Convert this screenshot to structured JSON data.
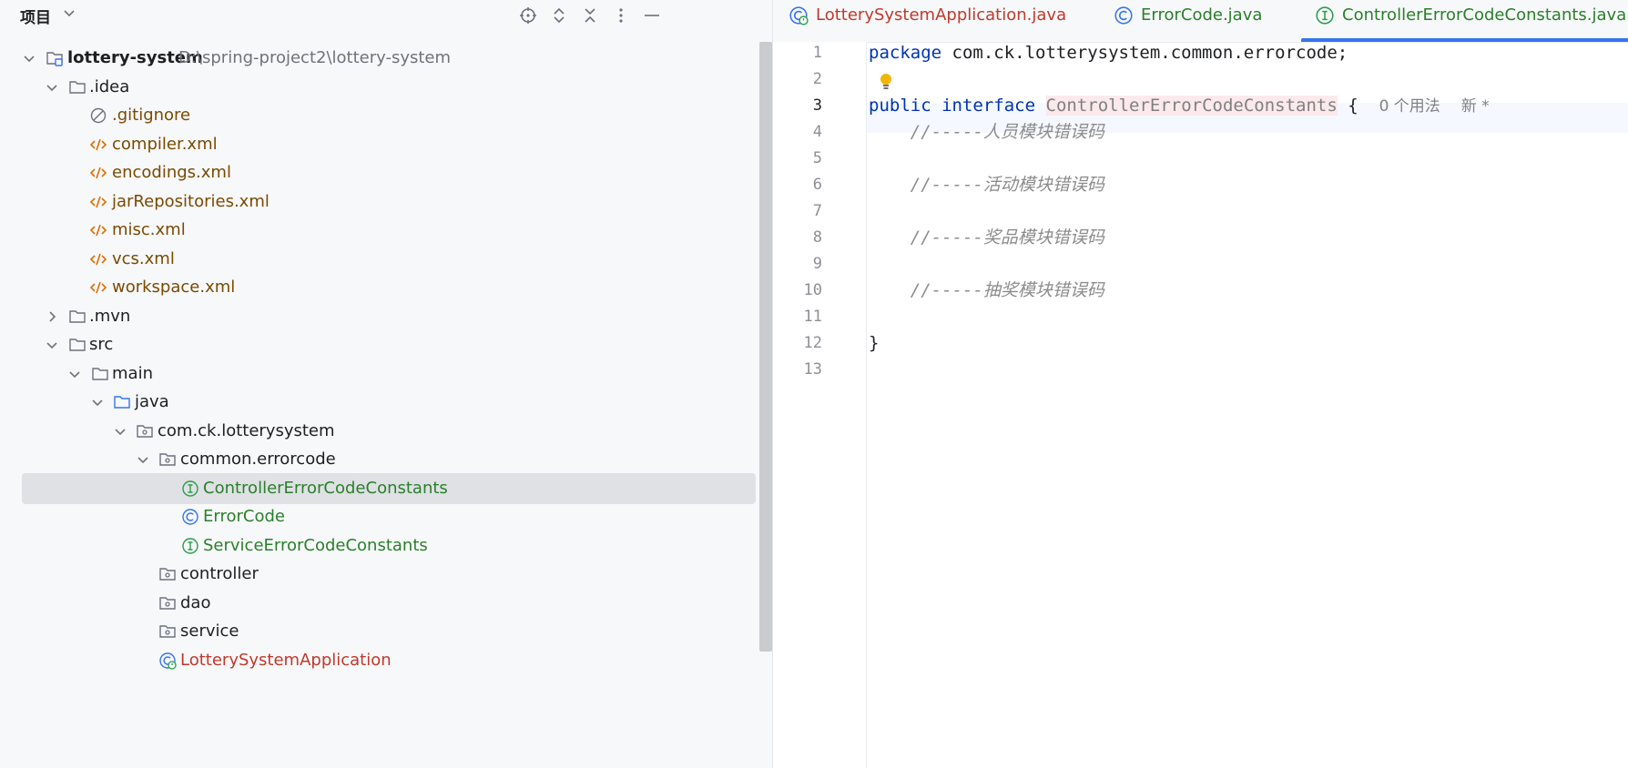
{
  "project_panel": {
    "title": "项目",
    "toolbar_icons": [
      "locate-icon",
      "expand-all-icon",
      "collapse-all-icon",
      "more-options-icon",
      "minimize-icon"
    ],
    "tree": [
      {
        "label": "lottery-system",
        "path": "D:\\spring-project2\\lottery-system",
        "icon": "module-folder-icon",
        "expanded": true
      },
      {
        "label": ".idea",
        "icon": "folder-icon",
        "expanded": true
      },
      {
        "label": ".gitignore",
        "icon": "ignored-file-icon"
      },
      {
        "label": "compiler.xml",
        "icon": "xml-file-icon"
      },
      {
        "label": "encodings.xml",
        "icon": "xml-file-icon"
      },
      {
        "label": "jarRepositories.xml",
        "icon": "xml-file-icon"
      },
      {
        "label": "misc.xml",
        "icon": "xml-file-icon"
      },
      {
        "label": "vcs.xml",
        "icon": "xml-file-icon"
      },
      {
        "label": "workspace.xml",
        "icon": "xml-file-icon"
      },
      {
        "label": ".mvn",
        "icon": "folder-icon",
        "expanded": false
      },
      {
        "label": "src",
        "icon": "folder-icon",
        "expanded": true
      },
      {
        "label": "main",
        "icon": "folder-icon",
        "expanded": true
      },
      {
        "label": "java",
        "icon": "source-folder-icon",
        "expanded": true
      },
      {
        "label": "com.ck.lotterysystem",
        "icon": "package-icon",
        "expanded": true
      },
      {
        "label": "common.errorcode",
        "icon": "package-icon",
        "expanded": true
      },
      {
        "label": "ControllerErrorCodeConstants",
        "icon": "interface-icon",
        "selected": true
      },
      {
        "label": "ErrorCode",
        "icon": "class-icon"
      },
      {
        "label": "ServiceErrorCodeConstants",
        "icon": "interface-icon"
      },
      {
        "label": "controller",
        "icon": "package-icon"
      },
      {
        "label": "dao",
        "icon": "package-icon"
      },
      {
        "label": "service",
        "icon": "package-icon"
      },
      {
        "label": "LotterySystemApplication",
        "icon": "spring-boot-class-icon"
      }
    ]
  },
  "editor": {
    "tabs": [
      {
        "label": "LotterySystemApplication.java",
        "icon": "spring-boot-class-icon",
        "color": "#c0392b"
      },
      {
        "label": "ErrorCode.java",
        "icon": "class-icon",
        "color": "#2a7f2a"
      },
      {
        "label": "ControllerErrorCodeConstants.java",
        "icon": "interface-icon",
        "color": "#2a7f2a",
        "active": true
      }
    ],
    "line_numbers": [
      "1",
      "2",
      "3",
      "4",
      "5",
      "6",
      "7",
      "8",
      "9",
      "10",
      "11",
      "12",
      "13"
    ],
    "current_line": "3",
    "code": {
      "l1_keyword": "package",
      "l1_rest": " com.ck.lotterysystem.common.errorcode;",
      "l3_kw1": "public",
      "l3_kw2": "interface",
      "l3_class": "ControllerErrorCodeConstants",
      "l3_brace": " {",
      "l3_usages": "0 个用法",
      "l3_new": "新 *",
      "l4_comment": "//-----人员模块错误码",
      "l6_comment": "//-----活动模块错误码",
      "l8_comment": "//-----奖品模块错误码",
      "l10_comment": "//-----抽奖模块错误码",
      "l12_brace": "}"
    },
    "colors": {
      "keyword": "#0033b3",
      "comment": "#8c8c8c",
      "accent": "#3574f0",
      "green_file": "#2a7f2a",
      "red_file": "#c0392b",
      "xml_file": "#7a4a00"
    }
  }
}
